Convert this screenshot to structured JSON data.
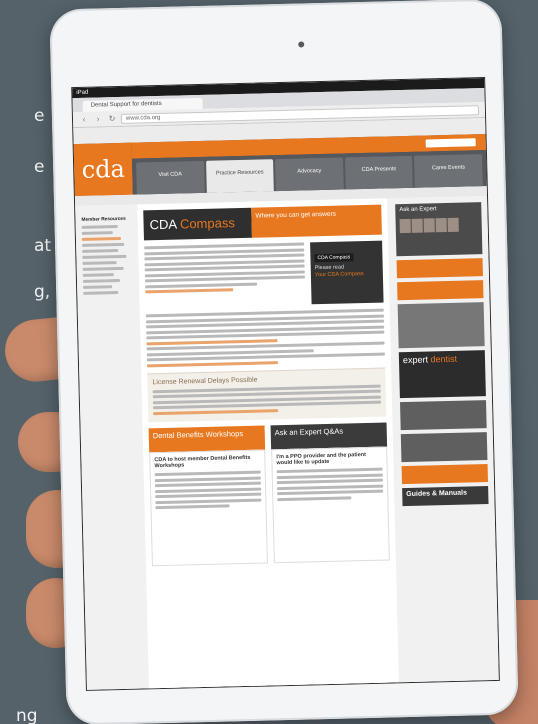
{
  "side_text": {
    "line1": "e",
    "line2": "e",
    "line3": "at",
    "line4": "g,",
    "line5": "ng"
  },
  "browser": {
    "status": "iPad",
    "tab_title": "Dental Support for dentists",
    "url": "www.cda.org"
  },
  "site": {
    "logo": "cda",
    "nav": [
      "Visit CDA",
      "Practice Resources",
      "Advocacy",
      "CDA Presents",
      "Cares Events"
    ],
    "active_nav_index": 1,
    "left_nav_heading": "Member Resources",
    "hero_title_part1": "CDA",
    "hero_title_part2": "Compass",
    "hero_tagline": "Where you can get answers",
    "dark_box_pill": "CDA Compass",
    "dark_box_text": "Please read",
    "dark_box_text2": "Your CDA Compass",
    "license_heading": "License Renewal Delays Possible",
    "dental_benefits_heading": "Dental Benefits Workshops",
    "dental_benefits_sub": "CDA to host member Dental Benefits Workshops",
    "ask_expert_heading": "Ask an Expert Q&As",
    "ask_expert_sub": "I'm a PPO provider and the patient would like to update",
    "right_ask_expert": "Ask an Expert",
    "right_expert_dentist_1": "expert",
    "right_expert_dentist_2": "dentist",
    "right_guides": "Guides & Manuals"
  }
}
